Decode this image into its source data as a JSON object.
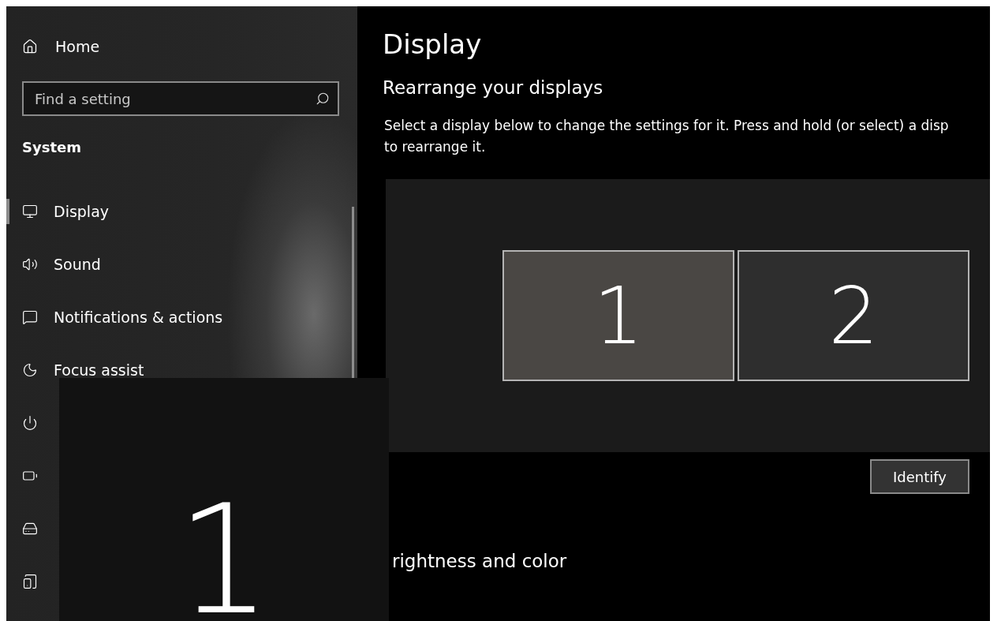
{
  "sidebar": {
    "home": {
      "label": "Home"
    },
    "search": {
      "placeholder": "Find a setting"
    },
    "section": "System",
    "items": [
      {
        "label": "Display",
        "selected": true
      },
      {
        "label": "Sound",
        "selected": false
      },
      {
        "label": "Notifications & actions",
        "selected": false
      },
      {
        "label": "Focus assist",
        "selected": false
      },
      {
        "selected": false
      },
      {
        "selected": false
      },
      {
        "selected": false
      },
      {
        "selected": false
      }
    ]
  },
  "main": {
    "title": "Display",
    "heading": "Rearrange your displays",
    "description": "Select a display below to change the settings for it. Press and hold (or select) a disp\nto rearrange it.",
    "monitors": [
      {
        "number": "1",
        "selected": true
      },
      {
        "number": "2",
        "selected": false
      }
    ],
    "identify_button": "Identify",
    "next_heading": "rightness and color"
  },
  "identify_overlay": {
    "number": "1"
  }
}
